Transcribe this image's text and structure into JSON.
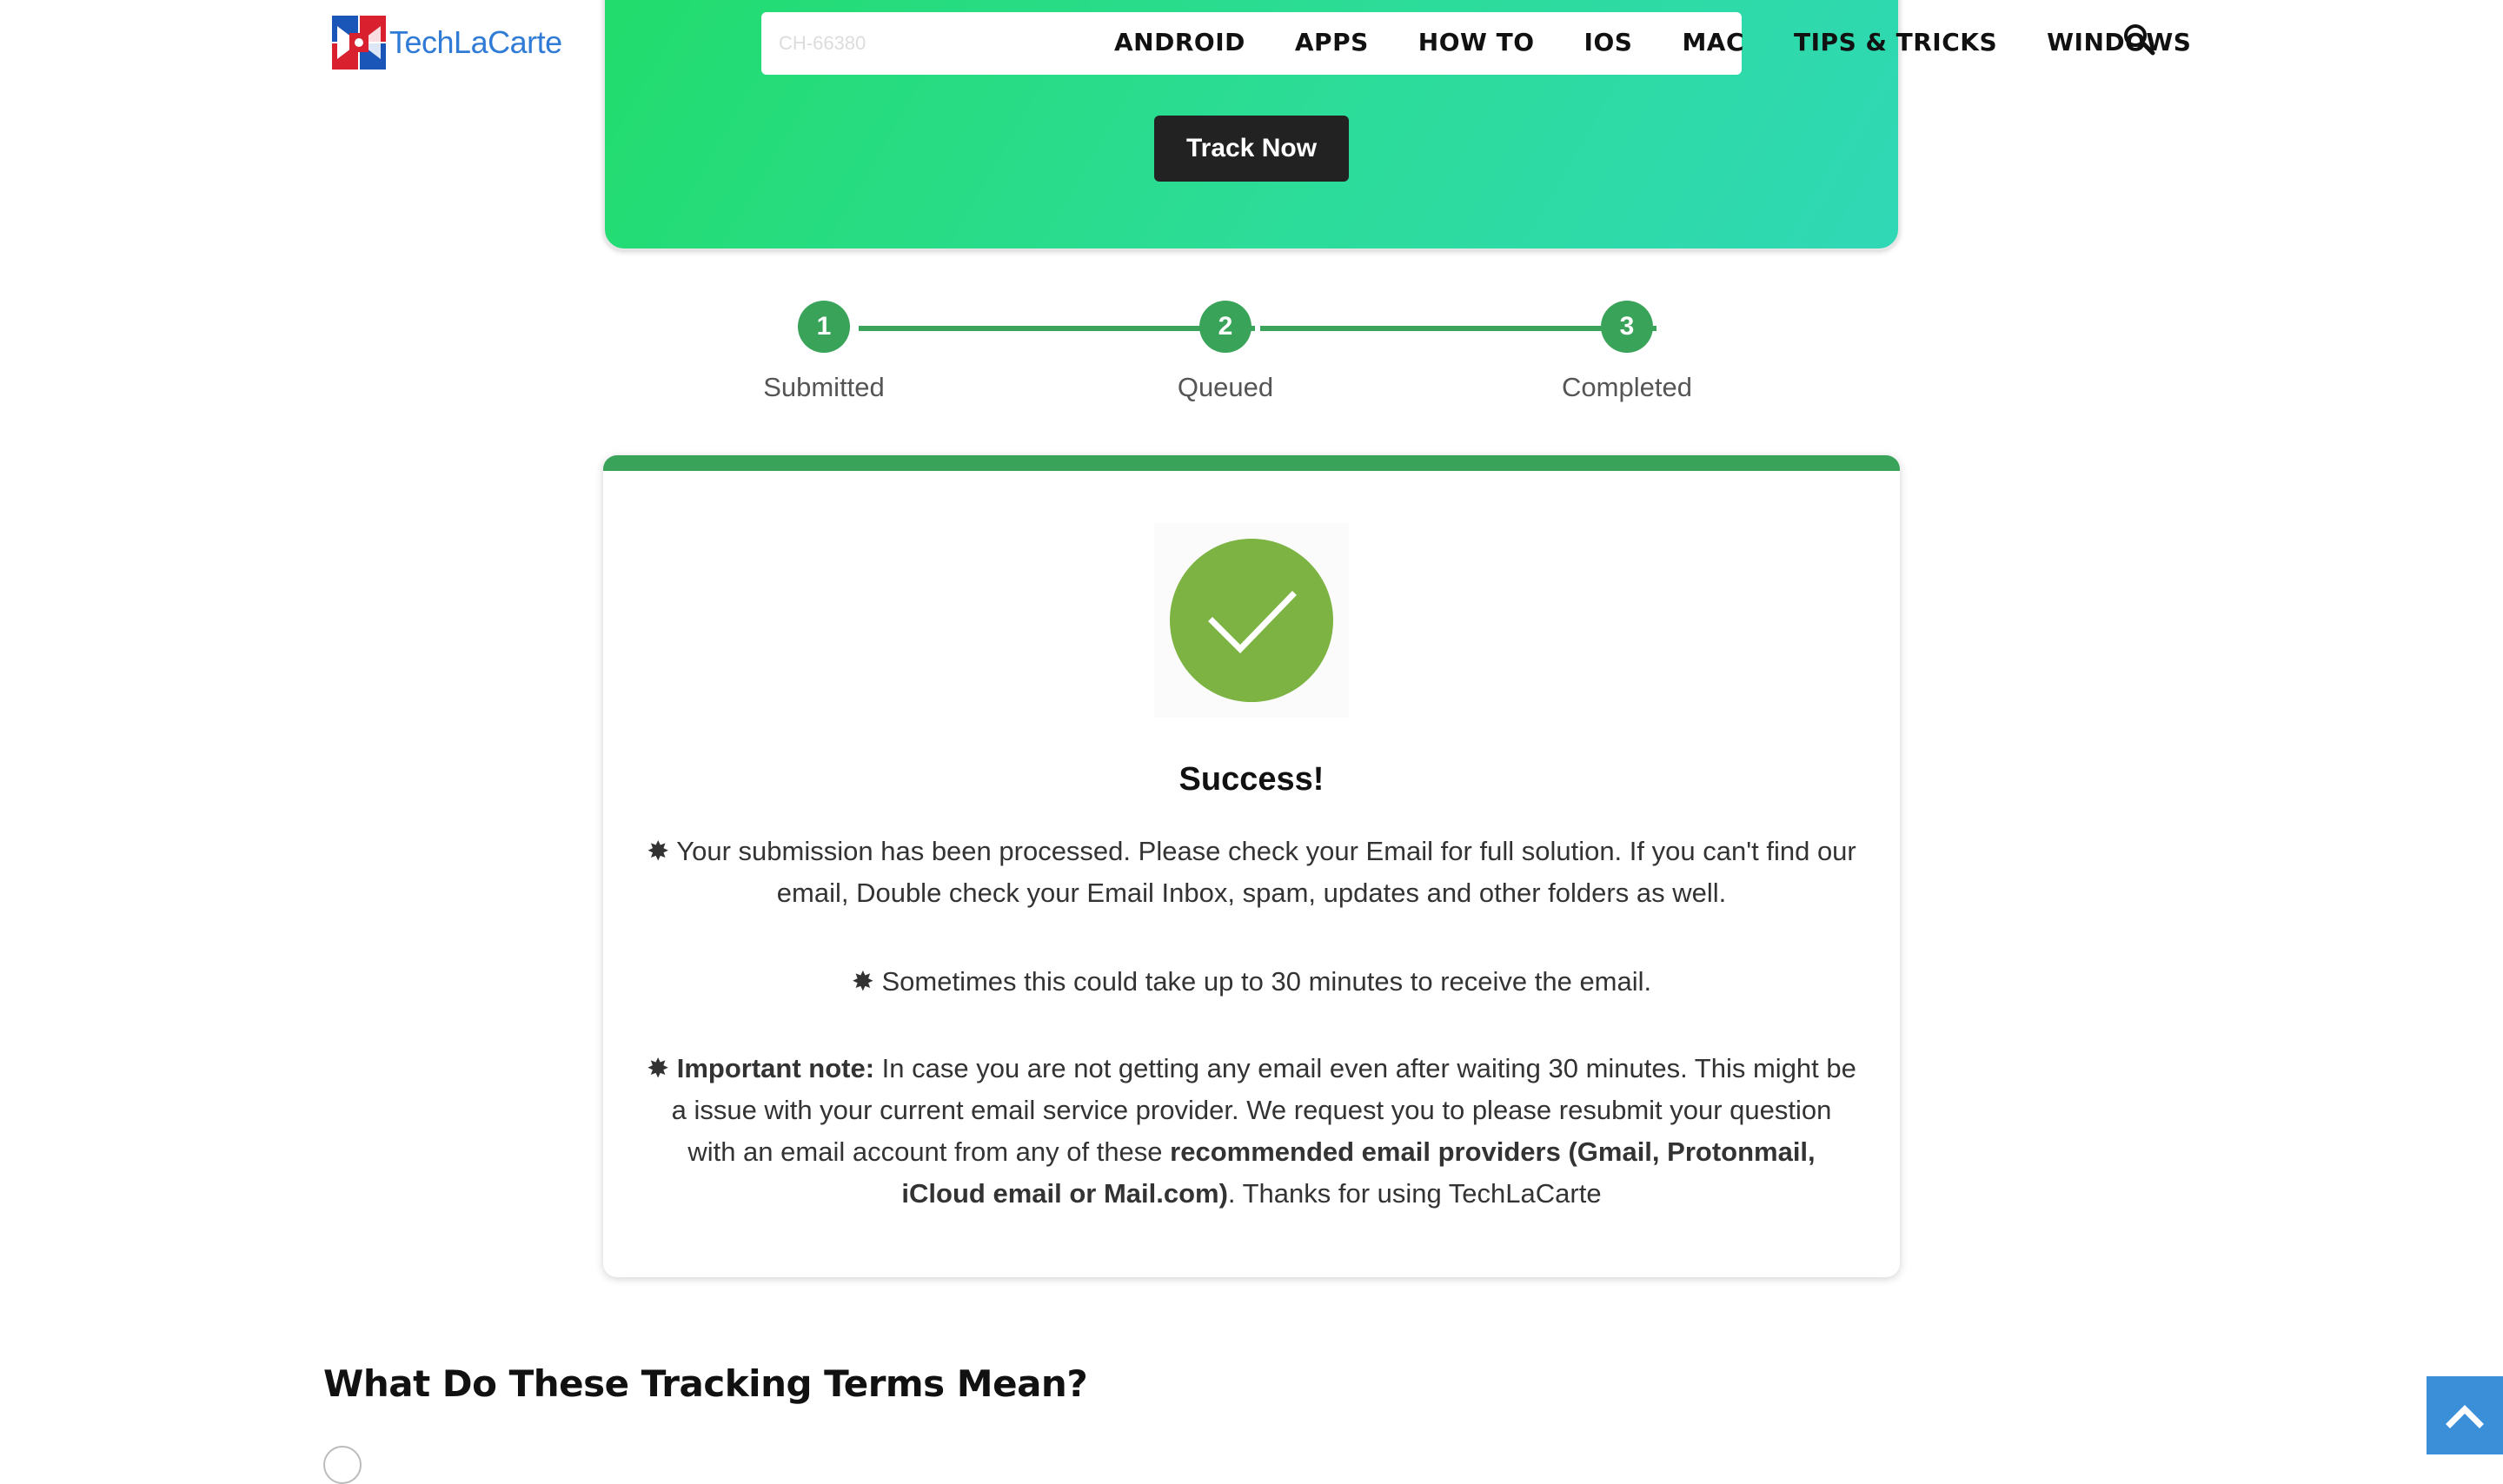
{
  "site": {
    "logo_text": "TechLaCarte"
  },
  "nav": {
    "items": [
      "ANDROID",
      "APPS",
      "HOW TO",
      "IOS",
      "MAC",
      "TIPS & TRICKS",
      "WINDOWS"
    ]
  },
  "tracker": {
    "input_placeholder": "CH-66380",
    "button_label": "Track Now"
  },
  "steps": [
    {
      "number": "1",
      "label": "Submitted"
    },
    {
      "number": "2",
      "label": "Queued"
    },
    {
      "number": "3",
      "label": "Completed"
    }
  ],
  "result": {
    "title": "Success!",
    "bullet": "✸",
    "message_1": "Your submission has been processed. Please check your Email for full solution. If you can't find our email, Double check your Email Inbox, spam, updates and other folders as well.",
    "message_2": "Sometimes this could take up to 30 minutes to receive the email.",
    "note_label": "Important note:",
    "note_text": "In case you are not getting any email even after waiting 30 minutes. This might be a issue with your current email service provider. We request you to please resubmit your question with an email account from any of these",
    "note_providers": "recommended email providers (Gmail, Protonmail, iCloud email or Mail.com)",
    "note_end": ". Thanks for using TechLaCarte"
  },
  "section": {
    "heading": "What Do These Tracking Terms Mean?"
  },
  "colors": {
    "accent_green": "#3aa35a",
    "check_green": "#7cb342",
    "hero_gradient_start": "#22dc6c",
    "hero_gradient_end": "#30d8b6",
    "button_dark": "#222222",
    "logo_blue": "#2f7bd6",
    "back_to_top_blue": "#3a8fd8"
  }
}
